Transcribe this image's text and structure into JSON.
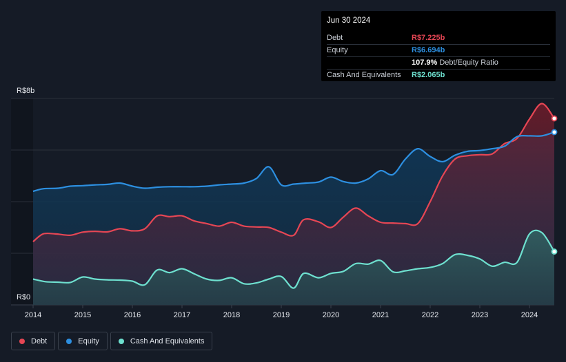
{
  "tooltip": {
    "date": "Jun 30 2024",
    "rows": [
      {
        "label": "Debt",
        "value": "R$7.225b",
        "color": "#e64654"
      },
      {
        "label": "Equity",
        "value": "R$6.694b",
        "color": "#2d8fe0"
      },
      {
        "label": "",
        "value": "107.9%",
        "suffix": "Debt/Equity Ratio",
        "color": "#ffffff"
      },
      {
        "label": "Cash And Equivalents",
        "value": "R$2.065b",
        "color": "#6ee0cf"
      }
    ]
  },
  "legend": [
    {
      "label": "Debt",
      "color": "#e64654"
    },
    {
      "label": "Equity",
      "color": "#2d8fe0"
    },
    {
      "label": "Cash And Equivalents",
      "color": "#6ee0cf"
    }
  ],
  "chart_data": {
    "type": "area",
    "y_tick_labels": [
      "R$8b",
      "R$0"
    ],
    "ylim": [
      0,
      8
    ],
    "xlim": [
      2014.0,
      2024.5
    ],
    "x_tick_labels": [
      "2014",
      "2015",
      "2016",
      "2017",
      "2018",
      "2019",
      "2020",
      "2021",
      "2022",
      "2023",
      "2024"
    ],
    "grid": true,
    "series": [
      {
        "name": "Debt",
        "color": "#e64654",
        "points": [
          [
            2014.0,
            2.45
          ],
          [
            2014.2,
            2.75
          ],
          [
            2014.45,
            2.75
          ],
          [
            2014.75,
            2.7
          ],
          [
            2015.0,
            2.82
          ],
          [
            2015.25,
            2.85
          ],
          [
            2015.5,
            2.83
          ],
          [
            2015.75,
            2.95
          ],
          [
            2016.0,
            2.87
          ],
          [
            2016.25,
            2.95
          ],
          [
            2016.5,
            3.45
          ],
          [
            2016.75,
            3.42
          ],
          [
            2017.0,
            3.45
          ],
          [
            2017.25,
            3.25
          ],
          [
            2017.5,
            3.15
          ],
          [
            2017.75,
            3.05
          ],
          [
            2018.0,
            3.2
          ],
          [
            2018.25,
            3.05
          ],
          [
            2018.5,
            3.02
          ],
          [
            2018.75,
            3.0
          ],
          [
            2019.0,
            2.82
          ],
          [
            2019.25,
            2.7
          ],
          [
            2019.45,
            3.3
          ],
          [
            2019.75,
            3.22
          ],
          [
            2020.0,
            3.0
          ],
          [
            2020.25,
            3.4
          ],
          [
            2020.5,
            3.75
          ],
          [
            2020.75,
            3.45
          ],
          [
            2021.0,
            3.2
          ],
          [
            2021.25,
            3.17
          ],
          [
            2021.5,
            3.15
          ],
          [
            2021.75,
            3.15
          ],
          [
            2022.0,
            4.0
          ],
          [
            2022.25,
            5.0
          ],
          [
            2022.5,
            5.65
          ],
          [
            2022.75,
            5.78
          ],
          [
            2023.0,
            5.82
          ],
          [
            2023.25,
            5.85
          ],
          [
            2023.5,
            6.25
          ],
          [
            2023.75,
            6.45
          ],
          [
            2024.0,
            7.2
          ],
          [
            2024.25,
            7.8
          ],
          [
            2024.5,
            7.225
          ]
        ]
      },
      {
        "name": "Equity",
        "color": "#2d8fe0",
        "points": [
          [
            2014.0,
            4.4
          ],
          [
            2014.2,
            4.5
          ],
          [
            2014.5,
            4.52
          ],
          [
            2014.75,
            4.6
          ],
          [
            2015.0,
            4.62
          ],
          [
            2015.25,
            4.65
          ],
          [
            2015.5,
            4.67
          ],
          [
            2015.75,
            4.72
          ],
          [
            2016.0,
            4.6
          ],
          [
            2016.25,
            4.52
          ],
          [
            2016.5,
            4.56
          ],
          [
            2016.75,
            4.58
          ],
          [
            2017.0,
            4.58
          ],
          [
            2017.25,
            4.58
          ],
          [
            2017.5,
            4.6
          ],
          [
            2017.75,
            4.65
          ],
          [
            2018.0,
            4.68
          ],
          [
            2018.25,
            4.72
          ],
          [
            2018.5,
            4.9
          ],
          [
            2018.75,
            5.35
          ],
          [
            2019.0,
            4.65
          ],
          [
            2019.25,
            4.68
          ],
          [
            2019.5,
            4.72
          ],
          [
            2019.75,
            4.76
          ],
          [
            2020.0,
            4.95
          ],
          [
            2020.25,
            4.78
          ],
          [
            2020.5,
            4.72
          ],
          [
            2020.75,
            4.88
          ],
          [
            2021.0,
            5.2
          ],
          [
            2021.25,
            5.05
          ],
          [
            2021.5,
            5.65
          ],
          [
            2021.75,
            6.05
          ],
          [
            2022.0,
            5.75
          ],
          [
            2022.25,
            5.55
          ],
          [
            2022.5,
            5.8
          ],
          [
            2022.75,
            5.95
          ],
          [
            2023.0,
            5.98
          ],
          [
            2023.25,
            6.05
          ],
          [
            2023.5,
            6.15
          ],
          [
            2023.75,
            6.52
          ],
          [
            2024.0,
            6.55
          ],
          [
            2024.25,
            6.55
          ],
          [
            2024.5,
            6.694
          ]
        ]
      },
      {
        "name": "Cash And Equivalents",
        "color": "#6ee0cf",
        "points": [
          [
            2014.0,
            1.0
          ],
          [
            2014.25,
            0.9
          ],
          [
            2014.5,
            0.88
          ],
          [
            2014.75,
            0.87
          ],
          [
            2015.0,
            1.08
          ],
          [
            2015.25,
            1.0
          ],
          [
            2015.5,
            0.97
          ],
          [
            2015.75,
            0.96
          ],
          [
            2016.0,
            0.92
          ],
          [
            2016.25,
            0.78
          ],
          [
            2016.5,
            1.35
          ],
          [
            2016.75,
            1.25
          ],
          [
            2017.0,
            1.4
          ],
          [
            2017.25,
            1.2
          ],
          [
            2017.5,
            1.0
          ],
          [
            2017.75,
            0.95
          ],
          [
            2018.0,
            1.05
          ],
          [
            2018.25,
            0.82
          ],
          [
            2018.5,
            0.85
          ],
          [
            2018.75,
            1.0
          ],
          [
            2019.0,
            1.1
          ],
          [
            2019.25,
            0.65
          ],
          [
            2019.45,
            1.22
          ],
          [
            2019.75,
            1.05
          ],
          [
            2020.0,
            1.22
          ],
          [
            2020.25,
            1.3
          ],
          [
            2020.5,
            1.6
          ],
          [
            2020.75,
            1.58
          ],
          [
            2021.0,
            1.72
          ],
          [
            2021.25,
            1.28
          ],
          [
            2021.5,
            1.32
          ],
          [
            2021.75,
            1.4
          ],
          [
            2022.0,
            1.45
          ],
          [
            2022.25,
            1.6
          ],
          [
            2022.5,
            1.95
          ],
          [
            2022.75,
            1.92
          ],
          [
            2023.0,
            1.78
          ],
          [
            2023.25,
            1.5
          ],
          [
            2023.5,
            1.65
          ],
          [
            2023.75,
            1.65
          ],
          [
            2024.0,
            2.75
          ],
          [
            2024.25,
            2.8
          ],
          [
            2024.5,
            2.065
          ]
        ]
      }
    ]
  }
}
